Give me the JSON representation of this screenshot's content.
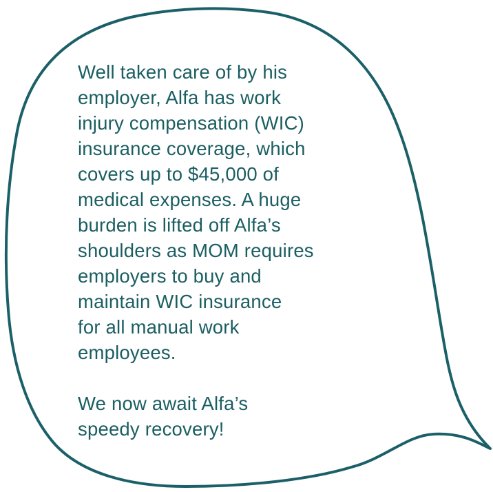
{
  "colors": {
    "outline": "#1b6068",
    "text": "#1b5e62",
    "fill": "#ffffff"
  },
  "bubble": {
    "paragraph1": [
      "Well taken care of by his",
      "employer, Alfa has work",
      "injury compensation (WIC)",
      "insurance coverage, which",
      "covers up to $45,000 of",
      "medical expenses. A huge",
      "burden is lifted off Alfa’s",
      "shoulders as MOM requires",
      "employers to buy and",
      "maintain WIC insurance",
      "for all manual work",
      "employees."
    ],
    "paragraph2": [
      "We now await Alfa’s",
      "speedy recovery!"
    ]
  }
}
